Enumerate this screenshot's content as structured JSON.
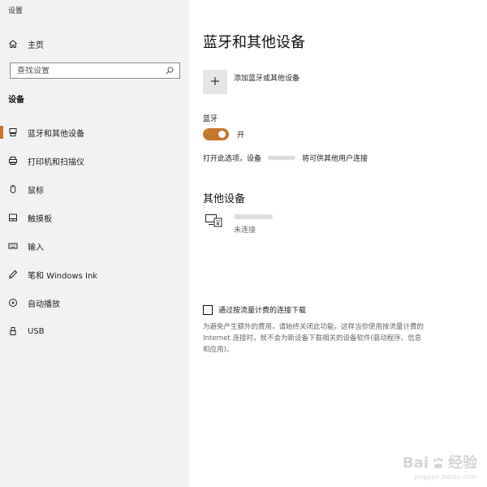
{
  "window": {
    "title": "设置"
  },
  "sidebar": {
    "home_label": "主页",
    "search_placeholder": "查找设置",
    "section_title": "设备",
    "items": [
      {
        "label": "蓝牙和其他设备",
        "icon": "bluetooth-device-icon",
        "active": true
      },
      {
        "label": "打印机和扫描仪",
        "icon": "printer-icon",
        "active": false
      },
      {
        "label": "鼠标",
        "icon": "mouse-icon",
        "active": false
      },
      {
        "label": "触摸板",
        "icon": "touchpad-icon",
        "active": false
      },
      {
        "label": "输入",
        "icon": "keyboard-icon",
        "active": false
      },
      {
        "label": "笔和 Windows Ink",
        "icon": "pen-icon",
        "active": false
      },
      {
        "label": "自动播放",
        "icon": "autoplay-icon",
        "active": false
      },
      {
        "label": "USB",
        "icon": "usb-icon",
        "active": false
      }
    ]
  },
  "main": {
    "title": "蓝牙和其他设备",
    "add_device_label": "添加蓝牙或其他设备",
    "bluetooth_label": "蓝牙",
    "bluetooth_state": "开",
    "discoverable_prefix": "打开此选项，设备",
    "discoverable_suffix": "将可供其他用户连接",
    "other_devices_title": "其他设备",
    "device_status": "未连接",
    "metered_label": "通过按流量计费的连接下载",
    "metered_description": "为避免产生额外的费用，请始终关闭此功能，这样当你使用按流量计费的\nInternet 连接时，就不会为新设备下载相关的设备软件(驱动程序、信息\n和应用)。"
  },
  "watermark": {
    "brand_left": "Bai",
    "brand_right": "经验",
    "url": "jingyan.baidu.com"
  },
  "colors": {
    "accent": "#c4772d",
    "sidebar_bg": "#f2f2f2",
    "button_bg": "#e6e6e6"
  }
}
